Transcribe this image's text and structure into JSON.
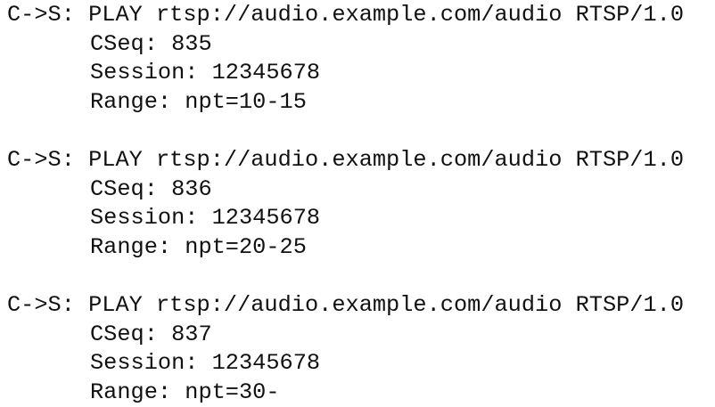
{
  "requests": [
    {
      "request_line": "C->S: PLAY rtsp://audio.example.com/audio RTSP/1.0",
      "cseq": "CSeq: 835",
      "session": "Session: 12345678",
      "range": "Range: npt=10-15"
    },
    {
      "request_line": "C->S: PLAY rtsp://audio.example.com/audio RTSP/1.0",
      "cseq": "CSeq: 836",
      "session": "Session: 12345678",
      "range": "Range: npt=20-25"
    },
    {
      "request_line": "C->S: PLAY rtsp://audio.example.com/audio RTSP/1.0",
      "cseq": "CSeq: 837",
      "session": "Session: 12345678",
      "range": "Range: npt=30-"
    }
  ]
}
